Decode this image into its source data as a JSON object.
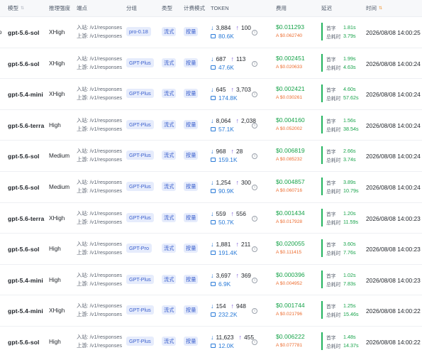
{
  "headers": {
    "model": "模型",
    "effort": "推理强度",
    "endpoint": "端点",
    "group": "分组",
    "type": "类型",
    "billing": "计费模式",
    "token": "TOKEN",
    "cost": "费用",
    "latency": "延迟",
    "time": "时间"
  },
  "icons": {
    "sort": "sort-icon",
    "input_tokens": "arrow-down-icon",
    "output_tokens": "arrow-up-icon",
    "cache": "cache-icon",
    "info": "info-icon"
  },
  "colors": {
    "cost": "#17a34a",
    "cost_sub": "#ec6b2d",
    "tag_bg": "#e6ecfc",
    "tag_text": "#3a5fcd",
    "latency_bar": "#22b35e",
    "cache_tokens": "#2b7bd8"
  },
  "labels": {
    "inbound": "入站:",
    "upstream": "上游:",
    "first_token": "首字",
    "total_time": "总耗时"
  },
  "rows": [
    {
      "edge": "o",
      "model": "gpt-5.6-sol",
      "effort": "XHigh",
      "ep_in": "/v1/responses",
      "ep_up": "/v1/responses",
      "group": "pro-0.18",
      "type": "流式",
      "billing": "按量",
      "tok_in": "3,884",
      "tok_out": "100",
      "tok_cache": "80.6K",
      "cost": "$0.011293",
      "cost_sub": "A $0.062740",
      "first": "1.81s",
      "total": "3.79s",
      "time": "2026/08/08 14:00:25"
    },
    {
      "edge": "",
      "model": "gpt-5.6-sol",
      "effort": "XHigh",
      "ep_in": "/v1/responses",
      "ep_up": "/v1/responses",
      "group": "GPT-Plus",
      "type": "流式",
      "billing": "按量",
      "tok_in": "687",
      "tok_out": "113",
      "tok_cache": "47.6K",
      "cost": "$0.002451",
      "cost_sub": "A $0.020633",
      "first": "1.99s",
      "total": "4.63s",
      "time": "2026/08/08 14:00:24"
    },
    {
      "edge": "",
      "model": "gpt-5.4-mini",
      "effort": "XHigh",
      "ep_in": "/v1/responses",
      "ep_up": "/v1/responses",
      "group": "GPT-Plus",
      "type": "流式",
      "billing": "按量",
      "tok_in": "645",
      "tok_out": "3,703",
      "tok_cache": "174.8K",
      "cost": "$0.002421",
      "cost_sub": "A $0.030261",
      "first": "4.60s",
      "total": "57.62s",
      "time": "2026/08/08 14:00:24"
    },
    {
      "edge": "",
      "model": "gpt-5.6-terra",
      "effort": "High",
      "ep_in": "/v1/responses",
      "ep_up": "/v1/responses",
      "group": "GPT-Plus",
      "type": "流式",
      "billing": "按量",
      "tok_in": "8,064",
      "tok_out": "2,038",
      "tok_cache": "57.1K",
      "cost": "$0.004160",
      "cost_sub": "A $0.052002",
      "first": "1.56s",
      "total": "38.54s",
      "time": "2026/08/08 14:00:24"
    },
    {
      "edge": "",
      "model": "gpt-5.6-sol",
      "effort": "Medium",
      "ep_in": "/v1/responses",
      "ep_up": "/v1/responses",
      "group": "GPT-Plus",
      "type": "流式",
      "billing": "按量",
      "tok_in": "968",
      "tok_out": "28",
      "tok_cache": "159.1K",
      "cost": "$0.006819",
      "cost_sub": "A $0.085232",
      "first": "2.66s",
      "total": "3.74s",
      "time": "2026/08/08 14:00:24"
    },
    {
      "edge": "",
      "model": "gpt-5.6-sol",
      "effort": "Medium",
      "ep_in": "/v1/responses",
      "ep_up": "/v1/responses",
      "group": "GPT-Plus",
      "type": "流式",
      "billing": "按量",
      "tok_in": "1,254",
      "tok_out": "300",
      "tok_cache": "90.9K",
      "cost": "$0.004857",
      "cost_sub": "A $0.060716",
      "first": "3.89s",
      "total": "10.79s",
      "time": "2026/08/08 14:00:24"
    },
    {
      "edge": "",
      "model": "gpt-5.6-terra",
      "effort": "XHigh",
      "ep_in": "/v1/responses",
      "ep_up": "/v1/responses",
      "group": "GPT-Plus",
      "type": "流式",
      "billing": "按量",
      "tok_in": "559",
      "tok_out": "556",
      "tok_cache": "50.7K",
      "cost": "$0.001434",
      "cost_sub": "A $0.017928",
      "first": "1.20s",
      "total": "11.59s",
      "time": "2026/08/08 14:00:23"
    },
    {
      "edge": "",
      "model": "gpt-5.6-sol",
      "effort": "High",
      "ep_in": "/v1/responses",
      "ep_up": "/v1/responses",
      "group": "GPT-Pro",
      "type": "流式",
      "billing": "按量",
      "tok_in": "1,881",
      "tok_out": "211",
      "tok_cache": "191.4K",
      "cost": "$0.020055",
      "cost_sub": "A $0.111415",
      "first": "3.60s",
      "total": "7.76s",
      "time": "2026/08/08 14:00:23"
    },
    {
      "edge": "",
      "model": "gpt-5.4-mini",
      "effort": "High",
      "ep_in": "/v1/responses",
      "ep_up": "/v1/responses",
      "group": "GPT-Plus",
      "type": "流式",
      "billing": "按量",
      "tok_in": "3,697",
      "tok_out": "369",
      "tok_cache": "6.9K",
      "cost": "$0.000396",
      "cost_sub": "A $0.004952",
      "first": "1.02s",
      "total": "7.83s",
      "time": "2026/08/08 14:00:23"
    },
    {
      "edge": "",
      "model": "gpt-5.4-mini",
      "effort": "XHigh",
      "ep_in": "/v1/responses",
      "ep_up": "/v1/responses",
      "group": "GPT-Plus",
      "type": "流式",
      "billing": "按量",
      "tok_in": "154",
      "tok_out": "948",
      "tok_cache": "232.2K",
      "cost": "$0.001744",
      "cost_sub": "A $0.021796",
      "first": "1.25s",
      "total": "15.46s",
      "time": "2026/08/08 14:00:22"
    },
    {
      "edge": "",
      "model": "gpt-5.6-sol",
      "effort": "High",
      "ep_in": "/v1/responses",
      "ep_up": "/v1/responses",
      "group": "GPT-Plus",
      "type": "流式",
      "billing": "按量",
      "tok_in": "11,623",
      "tok_out": "455",
      "tok_cache": "12.0K",
      "cost": "$0.006222",
      "cost_sub": "A $0.077781",
      "first": "1.48s",
      "total": "14.37s",
      "time": "2026/08/08 14:00:22"
    }
  ]
}
